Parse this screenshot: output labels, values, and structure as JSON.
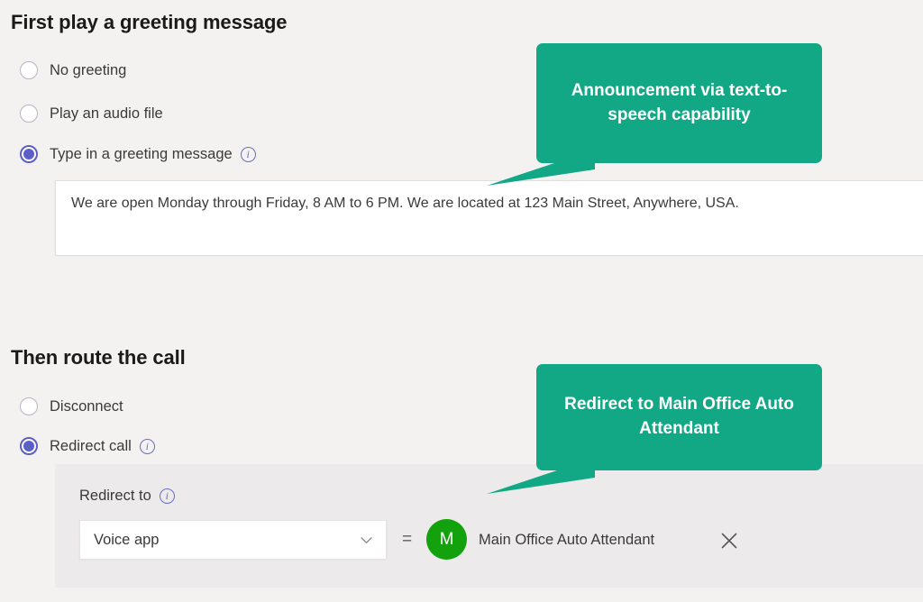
{
  "greeting_section": {
    "title": "First play a greeting message",
    "options": [
      {
        "label": "No greeting",
        "selected": false,
        "has_info": false
      },
      {
        "label": "Play an audio file",
        "selected": false,
        "has_info": false
      },
      {
        "label": "Type in a greeting message",
        "selected": true,
        "has_info": true
      }
    ],
    "info_glyph": "i",
    "textarea_value": "We are open Monday through Friday, 8 AM to 6 PM. We are located at 123 Main Street, Anywhere, USA."
  },
  "route_section": {
    "title": "Then route the call",
    "options": [
      {
        "label": "Disconnect",
        "selected": false,
        "has_info": false
      },
      {
        "label": "Redirect call",
        "selected": true,
        "has_info": true
      }
    ],
    "redirect_to_label": "Redirect to",
    "dropdown_value": "Voice app",
    "dropdown_icon": "chevron-down-icon",
    "equals_symbol": "=",
    "assignee": {
      "avatar_initial": "M",
      "avatar_color": "#13a10e",
      "name": "Main Office Auto Attendant",
      "remove_icon": "close-icon"
    }
  },
  "callouts": [
    {
      "id": "text-to-speech",
      "text": "Announcement via text-to-speech capability",
      "color": "#12a886"
    },
    {
      "id": "redirect-target",
      "text": "Redirect to Main Office Auto Attendant",
      "color": "#12a886"
    }
  ],
  "theme": {
    "page_background": "#f3f2f1",
    "panel_background": "#eceaea",
    "accent_purple": "#5b5fc7",
    "callout_green": "#12a886",
    "avatar_green": "#13a10e",
    "text_color": "#3b3a39"
  }
}
